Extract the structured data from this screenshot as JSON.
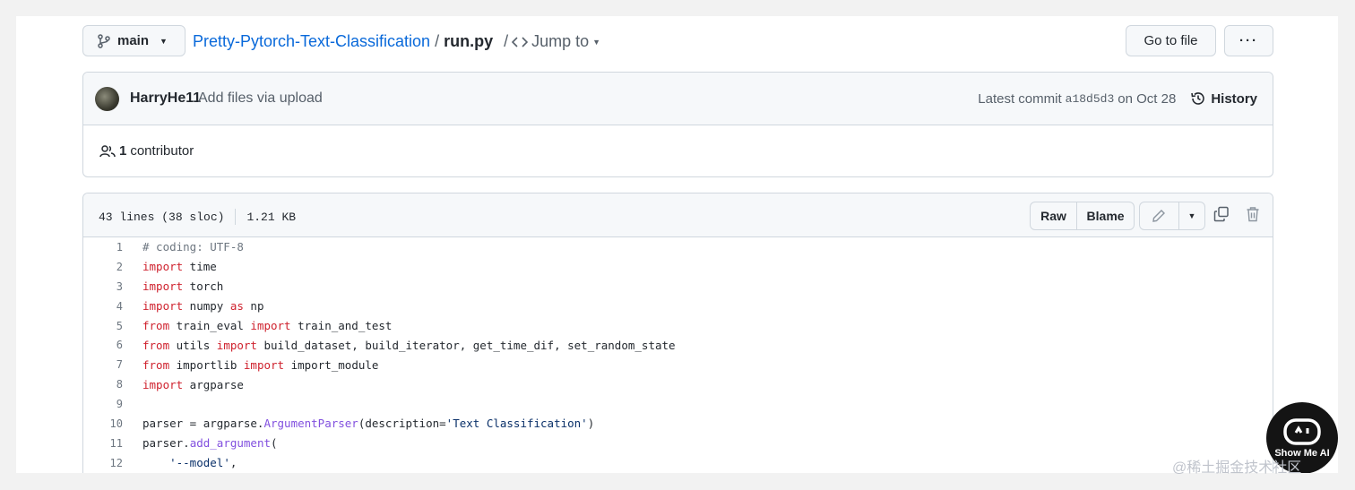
{
  "branch": {
    "name": "main"
  },
  "breadcrumb": {
    "repo": "Pretty-Pytorch-Text-Classification",
    "separator": "/",
    "file": "run.py",
    "jump_sep": "/",
    "jump_label": "Jump to"
  },
  "actions": {
    "go_to_file": "Go to file",
    "more": "···"
  },
  "commit": {
    "author": "HarryHe11",
    "message": "Add files via upload",
    "latest_label": "Latest commit",
    "sha": "a18d5d3",
    "date_text": "on Oct 28",
    "history_label": "History"
  },
  "contributors": {
    "count": "1",
    "label": "contributor"
  },
  "file": {
    "lines_info": "43 lines (38 sloc)",
    "size": "1.21 KB",
    "raw_label": "Raw",
    "blame_label": "Blame"
  },
  "code": [
    {
      "n": "1",
      "tokens": [
        {
          "t": "# coding: UTF-8",
          "c": "cm"
        }
      ]
    },
    {
      "n": "2",
      "tokens": [
        {
          "t": "import",
          "c": "kw"
        },
        {
          "t": " time",
          "c": ""
        }
      ]
    },
    {
      "n": "3",
      "tokens": [
        {
          "t": "import",
          "c": "kw"
        },
        {
          "t": " torch",
          "c": ""
        }
      ]
    },
    {
      "n": "4",
      "tokens": [
        {
          "t": "import",
          "c": "kw"
        },
        {
          "t": " numpy ",
          "c": ""
        },
        {
          "t": "as",
          "c": "kw"
        },
        {
          "t": " np",
          "c": ""
        }
      ]
    },
    {
      "n": "5",
      "tokens": [
        {
          "t": "from",
          "c": "kw"
        },
        {
          "t": " train_eval ",
          "c": ""
        },
        {
          "t": "import",
          "c": "kw"
        },
        {
          "t": " train_and_test",
          "c": ""
        }
      ]
    },
    {
      "n": "6",
      "tokens": [
        {
          "t": "from",
          "c": "kw"
        },
        {
          "t": " utils ",
          "c": ""
        },
        {
          "t": "import",
          "c": "kw"
        },
        {
          "t": " build_dataset, build_iterator, get_time_dif, set_random_state",
          "c": ""
        }
      ]
    },
    {
      "n": "7",
      "tokens": [
        {
          "t": "from",
          "c": "kw"
        },
        {
          "t": " importlib ",
          "c": ""
        },
        {
          "t": "import",
          "c": "kw"
        },
        {
          "t": " import_module",
          "c": ""
        }
      ]
    },
    {
      "n": "8",
      "tokens": [
        {
          "t": "import",
          "c": "kw"
        },
        {
          "t": " argparse",
          "c": ""
        }
      ]
    },
    {
      "n": "9",
      "tokens": []
    },
    {
      "n": "10",
      "tokens": [
        {
          "t": "parser = argparse.",
          "c": ""
        },
        {
          "t": "ArgumentParser",
          "c": "fn"
        },
        {
          "t": "(description=",
          "c": ""
        },
        {
          "t": "'Text Classification'",
          "c": "str"
        },
        {
          "t": ")",
          "c": ""
        }
      ]
    },
    {
      "n": "11",
      "tokens": [
        {
          "t": "parser.",
          "c": ""
        },
        {
          "t": "add_argument",
          "c": "fn"
        },
        {
          "t": "(",
          "c": ""
        }
      ]
    },
    {
      "n": "12",
      "tokens": [
        {
          "t": "    ",
          "c": ""
        },
        {
          "t": "'--model'",
          "c": "str"
        },
        {
          "t": ",",
          "c": ""
        }
      ]
    }
  ],
  "watermark": {
    "label": "Show Me AI"
  },
  "site_text": "@稀土掘金技术社区"
}
